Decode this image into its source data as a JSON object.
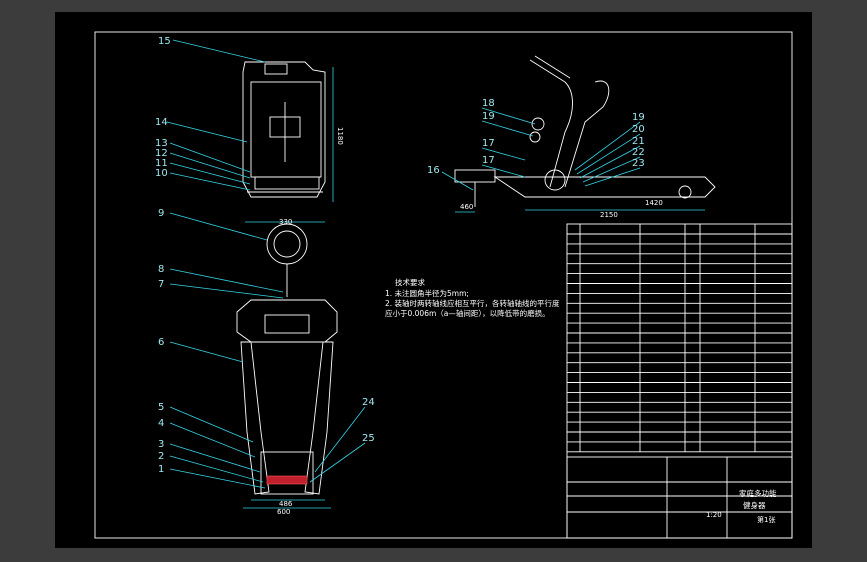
{
  "labels": {
    "l1": "1",
    "l2": "2",
    "l3": "3",
    "l4": "4",
    "l5": "5",
    "l6": "6",
    "l7": "7",
    "l8": "8",
    "l9": "9",
    "l10": "10",
    "l11": "11",
    "l12": "12",
    "l13": "13",
    "l14": "14",
    "l15": "15",
    "l16": "16",
    "l17a": "17",
    "l17b": "17",
    "l18": "18",
    "l19": "19",
    "l20": "20",
    "l21": "21",
    "l22": "22",
    "l23": "23",
    "l24": "24",
    "l25": "25"
  },
  "dims": {
    "d1": "1180",
    "d2": "2150",
    "d3": "460",
    "d4": "1420",
    "d5": "330",
    "d6": "600",
    "d7": "486"
  },
  "notes": {
    "title": "技术要求",
    "line1": "1. 未注圆角半径为5mm;",
    "line2": "2. 装轴时两转轴线应相互平行，各转轴轴线的平行度",
    "line3": "   应小于0.006m（a—轴间距），以降低带的磨损。"
  },
  "title_block": {
    "name1": "家庭多功能",
    "name2": "健身器",
    "scale": "1:20",
    "sheet": "第1张"
  }
}
